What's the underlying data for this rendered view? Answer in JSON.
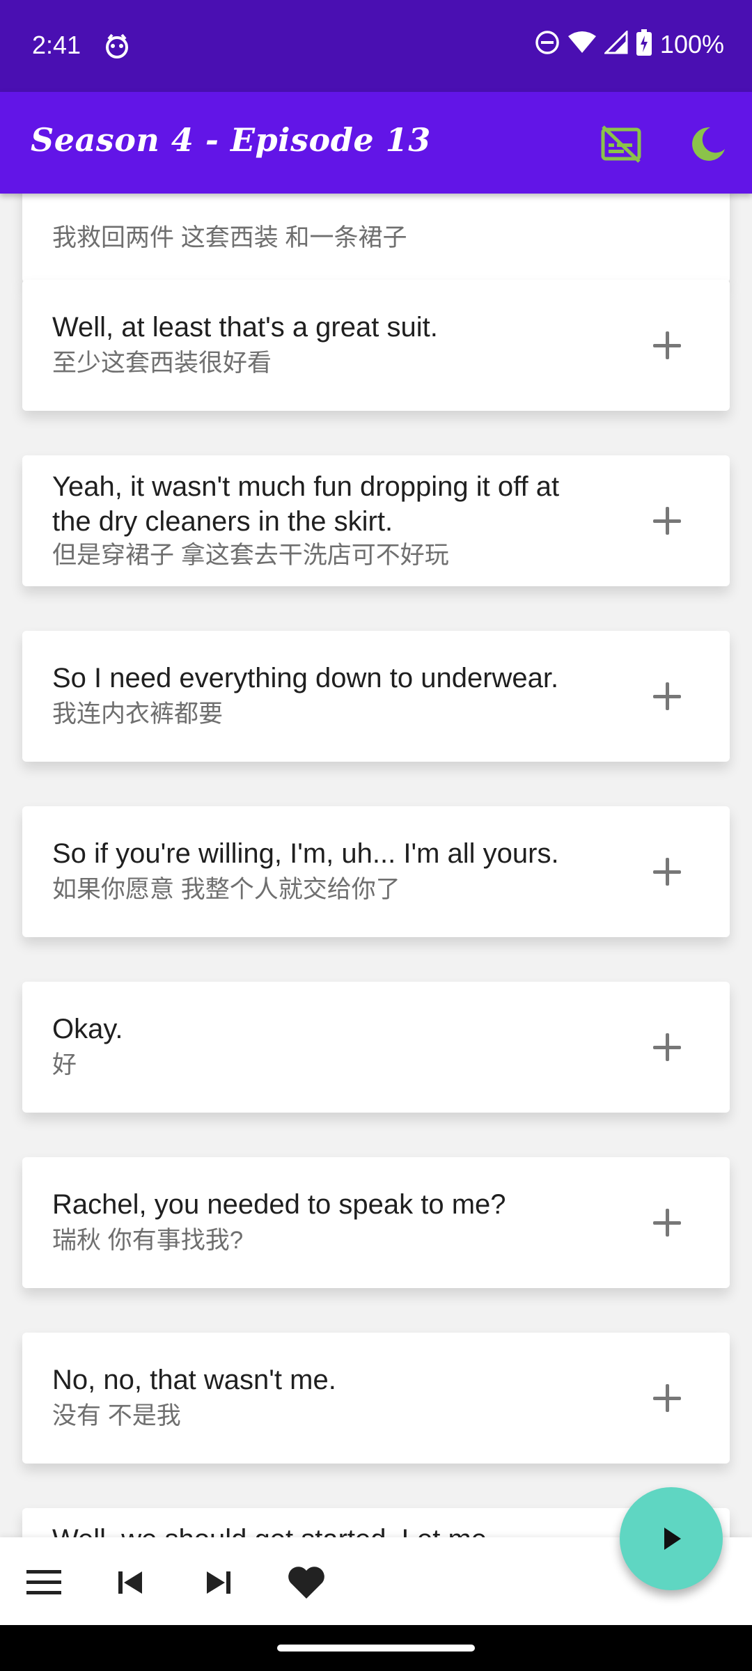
{
  "status": {
    "time": "2:41",
    "battery": "100%",
    "icons": [
      "dnd-icon",
      "wifi-icon",
      "signal-icon",
      "battery-charging-icon"
    ]
  },
  "app_bar": {
    "title": "Season 4 - Episode 13",
    "icons": [
      "subtitles-off-icon",
      "dark-mode-icon"
    ],
    "accent": "#8bc34a"
  },
  "subtitles": [
    {
      "en": "",
      "zh": "我救回两件 这套西装 和一条裙子"
    },
    {
      "en": "Well, at least that's a great suit.",
      "zh": "至少这套西装很好看"
    },
    {
      "en": "Yeah, it wasn't much fun dropping it off at the dry cleaners in the skirt.",
      "zh": "但是穿裙子 拿这套去干洗店可不好玩"
    },
    {
      "en": "So I need everything down to underwear.",
      "zh": "我连内衣裤都要"
    },
    {
      "en": "So if you're willing, I'm, uh... I'm all yours.",
      "zh": "如果你愿意 我整个人就交给你了"
    },
    {
      "en": "Okay.",
      "zh": "好"
    },
    {
      "en": "Rachel, you needed to speak to me?",
      "zh": "瑞秋 你有事找我?"
    },
    {
      "en": "No, no, that wasn't me.",
      "zh": "没有 不是我"
    },
    {
      "en": "Well, we should get started. Let me",
      "zh": ""
    }
  ],
  "bottom_bar": {
    "icons": [
      "menu-icon",
      "skip-previous-icon",
      "skip-next-icon",
      "favorite-icon"
    ],
    "fab_icon": "play-icon",
    "fab_color": "#5fd6c2"
  }
}
